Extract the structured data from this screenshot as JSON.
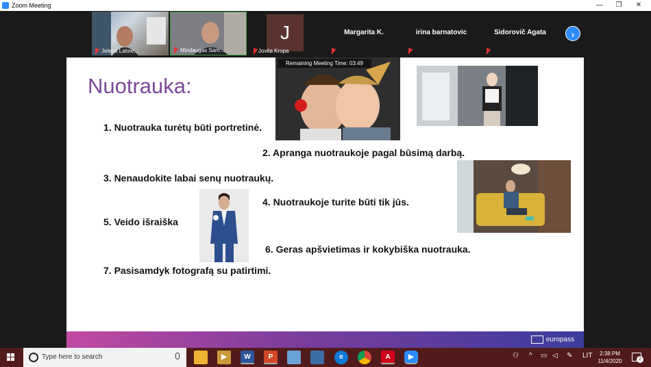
{
  "window": {
    "title": "Zoom Meeting",
    "minimize": "—",
    "maximize": "❐",
    "close": "✕"
  },
  "participants": [
    {
      "name": "Jelena Latvie..."
    },
    {
      "name": "Mindaugas Sam..."
    },
    {
      "name": "Jovita Kropa",
      "initial": "J"
    },
    {
      "name": "Margarita K."
    },
    {
      "name": "irina barnatovic"
    },
    {
      "name": "Sidorovič Agata"
    }
  ],
  "next_label": "›",
  "slide": {
    "title": "Nuotrauka:",
    "items": [
      "1. Nuotrauka turėtų būti portretinė.",
      "2. Apranga nuotraukoje pagal būsimą darbą.",
      "3. Nenaudokite labai senų nuotraukų.",
      "4. Nuotraukoje turite būti tik jūs.",
      "5. Veido išraiška",
      "6. Geras apšvietimas ir kokybiška nuotrauka.",
      "7. Pasisamdyk fotografą su patirtimi."
    ],
    "timer": "Remaining Meeting Time: 03:49",
    "brand": "europass"
  },
  "taskbar": {
    "search_placeholder": "Type here to search",
    "apps": [
      {
        "name": "file-explorer",
        "glyph": "",
        "color": "#f0b232"
      },
      {
        "name": "media-player",
        "glyph": "▶",
        "color": "#c99a3a"
      },
      {
        "name": "word",
        "glyph": "W",
        "color": "#2b579a"
      },
      {
        "name": "powerpoint",
        "glyph": "P",
        "color": "#d24726"
      },
      {
        "name": "paint",
        "glyph": "",
        "color": "#6aa3d6"
      },
      {
        "name": "calculator",
        "glyph": "",
        "color": "#3a6ea5"
      },
      {
        "name": "edge",
        "glyph": "e",
        "color": "#0f7bd6"
      },
      {
        "name": "chrome",
        "glyph": "",
        "color": "#2f9e46"
      },
      {
        "name": "acrobat",
        "glyph": "A",
        "color": "#d0021b"
      },
      {
        "name": "zoom",
        "glyph": "▶",
        "color": "#2d8cff"
      }
    ],
    "language": "LIT",
    "time": "2:38 PM",
    "date": "11/4/2020",
    "notifications": "2"
  }
}
